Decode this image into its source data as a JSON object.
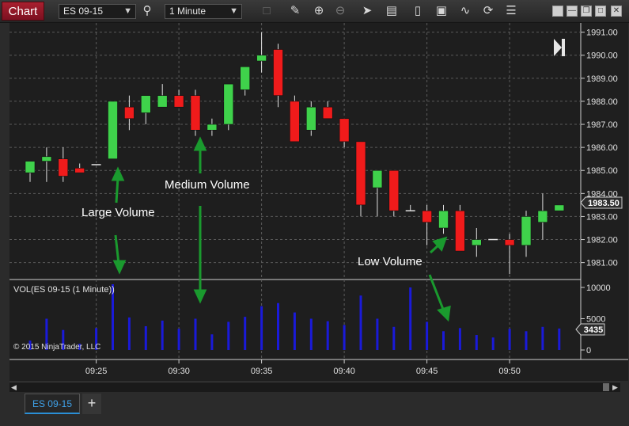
{
  "toolbar": {
    "chart_label": "Chart",
    "instrument": "ES 09-15",
    "interval": "1 Minute",
    "icons": [
      "search-icon",
      "pencil-icon",
      "zoom-in-icon",
      "zoom-out-icon",
      "pointer-icon",
      "properties-icon",
      "bar-type-icon",
      "strategies-icon",
      "indicators-icon",
      "reload-icon",
      "list-icon"
    ]
  },
  "window_buttons": [
    "minimize",
    "restore",
    "maximize",
    "close"
  ],
  "price_axis": {
    "ticks": [
      "1991.00",
      "1990.00",
      "1989.00",
      "1988.00",
      "1987.00",
      "1986.00",
      "1985.00",
      "1984.00",
      "1983.00",
      "1982.00",
      "1981.00"
    ],
    "last_price": "1983.50"
  },
  "volume_panel": {
    "label": "VOL(ES 09-15 (1 Minute))",
    "ticks": [
      "10000",
      "5000",
      "0"
    ],
    "last_volume": "3435",
    "copyright": "© 2015 NinjaTrader, LLC"
  },
  "time_axis": {
    "ticks": [
      "09:25",
      "09:30",
      "09:35",
      "09:40",
      "09:45",
      "09:50"
    ]
  },
  "annotations": {
    "large": "Large Volume",
    "medium": "Medium Volume",
    "low": "Low Volume"
  },
  "colors": {
    "up": "#3fd24b",
    "down": "#f01b1b",
    "volume": "#1a1ad9",
    "arrow": "#1a9a2e"
  },
  "tabs": {
    "series_tab": "ES 09-15",
    "add_tab": "+"
  },
  "chart_data": [
    {
      "type": "candlestick",
      "x": [
        "09:21",
        "09:22",
        "09:23",
        "09:24",
        "09:25",
        "09:26",
        "09:27",
        "09:28",
        "09:29",
        "09:30",
        "09:31",
        "09:32",
        "09:33",
        "09:34",
        "09:35",
        "09:36",
        "09:37",
        "09:38",
        "09:39",
        "09:40",
        "09:41",
        "09:42",
        "09:43",
        "09:44",
        "09:45",
        "09:46",
        "09:47",
        "09:48",
        "09:49",
        "09:50",
        "09:51",
        "09:52",
        "09:53"
      ],
      "open": [
        1984.9,
        1985.4,
        1985.5,
        1985.1,
        1985.25,
        1985.5,
        1987.75,
        1987.5,
        1987.75,
        1988.25,
        1988.25,
        1986.75,
        1987.0,
        1988.5,
        1989.75,
        1990.25,
        1988.0,
        1986.75,
        1987.75,
        1987.25,
        1986.25,
        1984.25,
        1985.0,
        1983.25,
        1983.25,
        1982.5,
        1983.25,
        1981.75,
        1982.0,
        1982.0,
        1981.75,
        1982.75,
        1983.25
      ],
      "high": [
        1985.0,
        1986.0,
        1986.0,
        1985.3,
        1985.25,
        1988.0,
        1988.25,
        1988.25,
        1988.75,
        1988.5,
        1988.5,
        1987.25,
        1987.5,
        1989.0,
        1991.0,
        1990.5,
        1988.25,
        1988.0,
        1988.0,
        1987.25,
        1986.25,
        1985.0,
        1985.0,
        1983.5,
        1983.5,
        1983.5,
        1983.5,
        1982.5,
        1982.0,
        1982.25,
        1983.25,
        1984.0,
        1983.5
      ],
      "high_note": "approx",
      "low": [
        1984.5,
        1984.5,
        1984.5,
        1985.0,
        1985.25,
        1985.5,
        1986.75,
        1987.0,
        1987.75,
        1988.0,
        1986.5,
        1986.5,
        1986.75,
        1988.25,
        1989.25,
        1987.75,
        1986.5,
        1986.5,
        1987.25,
        1986.0,
        1983.0,
        1983.0,
        1983.0,
        1983.25,
        1981.75,
        1982.25,
        1981.5,
        1981.25,
        1982.0,
        1980.5,
        1981.25,
        1982.0,
        1983.25
      ],
      "close": [
        1985.4,
        1985.6,
        1984.75,
        1984.9,
        1985.25,
        1988.0,
        1987.25,
        1988.25,
        1988.25,
        1987.75,
        1986.75,
        1987.0,
        1988.75,
        1989.5,
        1990.0,
        1988.25,
        1986.25,
        1987.75,
        1987.25,
        1986.25,
        1983.5,
        1985.0,
        1983.25,
        1983.25,
        1982.75,
        1983.25,
        1981.5,
        1982.0,
        1982.0,
        1981.75,
        1983.0,
        1983.25,
        1983.5
      ],
      "ylim": [
        1980.3,
        1991.4
      ]
    },
    {
      "type": "bar",
      "title": "VOL(ES 09-15 (1 Minute))",
      "x": [
        "09:21",
        "09:22",
        "09:23",
        "09:24",
        "09:25",
        "09:26",
        "09:27",
        "09:28",
        "09:29",
        "09:30",
        "09:31",
        "09:32",
        "09:33",
        "09:34",
        "09:35",
        "09:36",
        "09:37",
        "09:38",
        "09:39",
        "09:40",
        "09:41",
        "09:42",
        "09:43",
        "09:44",
        "09:45",
        "09:46",
        "09:47",
        "09:48",
        "09:49",
        "09:50",
        "09:51",
        "09:52",
        "09:53"
      ],
      "values": [
        1500,
        5000,
        3200,
        1000,
        3500,
        10500,
        5200,
        3800,
        4700,
        3400,
        5000,
        2500,
        4500,
        5300,
        7000,
        7500,
        6000,
        5000,
        4600,
        4000,
        8700,
        5000,
        3700,
        10000,
        4500,
        3000,
        3500,
        2400,
        2000,
        3400,
        3000,
        3700,
        3435
      ],
      "ylim": [
        0,
        11000
      ],
      "yticks": [
        0,
        5000,
        10000
      ]
    }
  ]
}
